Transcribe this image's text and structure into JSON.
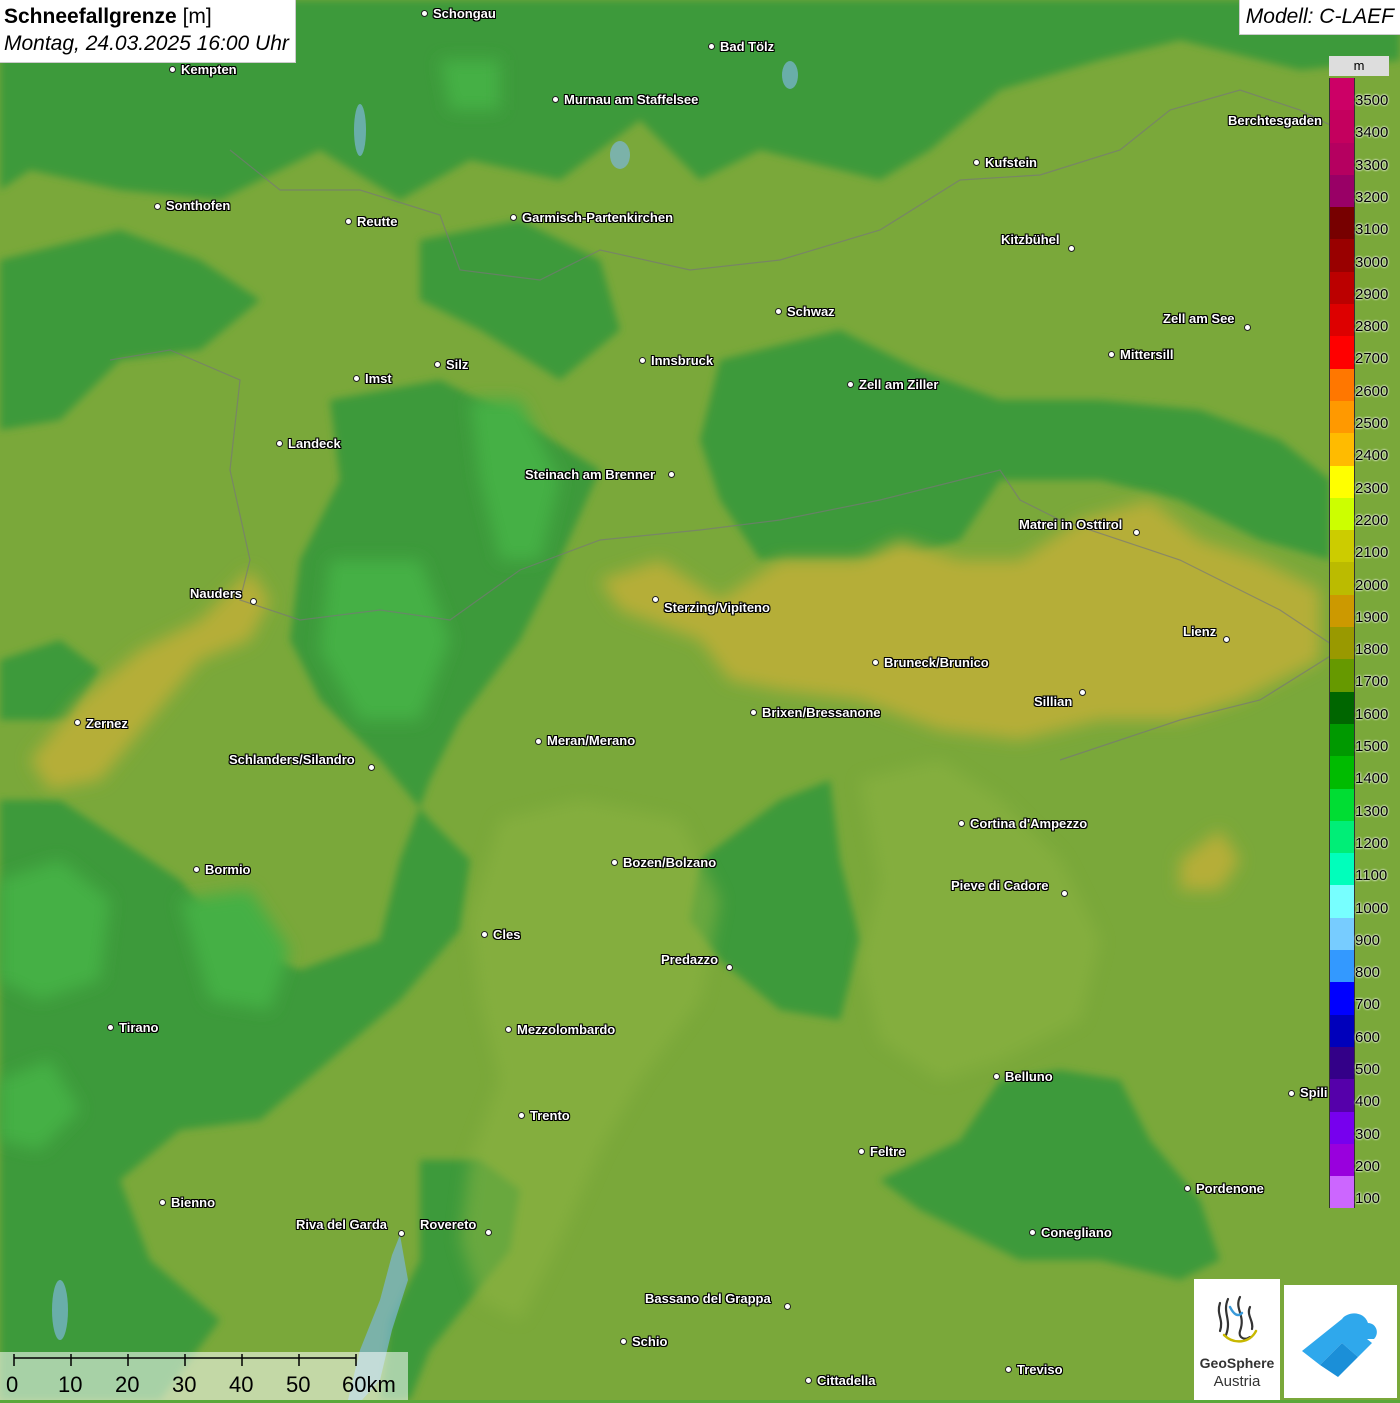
{
  "header": {
    "title_bold": "Schneefallgrenze",
    "title_unit": "[m]",
    "date": "Montag, 24.03.2025 16:00 Uhr",
    "model": "Modell: C-LAEF"
  },
  "legend": {
    "unit": "m",
    "items": [
      {
        "label": "3500",
        "color": "#cc0066"
      },
      {
        "label": "3400",
        "color": "#c4005e"
      },
      {
        "label": "3300",
        "color": "#b50060"
      },
      {
        "label": "3200",
        "color": "#990066"
      },
      {
        "label": "3100",
        "color": "#770000"
      },
      {
        "label": "3000",
        "color": "#990000"
      },
      {
        "label": "2900",
        "color": "#bb0000"
      },
      {
        "label": "2800",
        "color": "#dd0000"
      },
      {
        "label": "2700",
        "color": "#ff0000"
      },
      {
        "label": "2600",
        "color": "#ff7700"
      },
      {
        "label": "2500",
        "color": "#ff9900"
      },
      {
        "label": "2400",
        "color": "#ffbb00"
      },
      {
        "label": "2300",
        "color": "#ffff00"
      },
      {
        "label": "2200",
        "color": "#ccff00"
      },
      {
        "label": "2100",
        "color": "#cccc00"
      },
      {
        "label": "2000",
        "color": "#bbbb00"
      },
      {
        "label": "1900",
        "color": "#cc9900"
      },
      {
        "label": "1800",
        "color": "#999900"
      },
      {
        "label": "1700",
        "color": "#669900"
      },
      {
        "label": "1600",
        "color": "#006600"
      },
      {
        "label": "1500",
        "color": "#009900"
      },
      {
        "label": "1400",
        "color": "#00bb00"
      },
      {
        "label": "1300",
        "color": "#00dd33"
      },
      {
        "label": "1200",
        "color": "#00ee77"
      },
      {
        "label": "1100",
        "color": "#00ffbb"
      },
      {
        "label": "1000",
        "color": "#77ffff"
      },
      {
        "label": "900",
        "color": "#77ccff"
      },
      {
        "label": "800",
        "color": "#3399ff"
      },
      {
        "label": "700",
        "color": "#0000ff"
      },
      {
        "label": "600",
        "color": "#0000bb"
      },
      {
        "label": "500",
        "color": "#330088"
      },
      {
        "label": "400",
        "color": "#5500aa"
      },
      {
        "label": "300",
        "color": "#7700ee"
      },
      {
        "label": "200",
        "color": "#9900dd"
      },
      {
        "label": "100",
        "color": "#cc66ff"
      }
    ]
  },
  "cities": [
    {
      "name": "Schongau",
      "dot": [
        424,
        13
      ],
      "label": [
        433,
        14
      ],
      "align": "left"
    },
    {
      "name": "Kempten",
      "dot": [
        172,
        69
      ],
      "label": [
        181,
        70
      ],
      "align": "left"
    },
    {
      "name": "Bad Tölz",
      "dot": [
        711,
        46
      ],
      "label": [
        720,
        47
      ],
      "align": "left"
    },
    {
      "name": "Murnau am Staffelsee",
      "dot": [
        555,
        99
      ],
      "label": [
        564,
        100
      ],
      "align": "left"
    },
    {
      "name": "Berchtesgaden",
      "dot": null,
      "label": [
        1228,
        121
      ],
      "align": "left"
    },
    {
      "name": "Kufstein",
      "dot": [
        976,
        162
      ],
      "label": [
        985,
        163
      ],
      "align": "left"
    },
    {
      "name": "Sonthofen",
      "dot": [
        157,
        206
      ],
      "label": [
        166,
        206
      ],
      "align": "left"
    },
    {
      "name": "Reutte",
      "dot": [
        348,
        221
      ],
      "label": [
        357,
        222
      ],
      "align": "left"
    },
    {
      "name": "Garmisch-Partenkirchen",
      "dot": [
        513,
        217
      ],
      "label": [
        522,
        218
      ],
      "align": "left"
    },
    {
      "name": "Kitzbühel",
      "dot": [
        1071,
        248
      ],
      "label": [
        1001,
        240
      ],
      "align": "left"
    },
    {
      "name": "Schwaz",
      "dot": [
        778,
        311
      ],
      "label": [
        787,
        312
      ],
      "align": "left"
    },
    {
      "name": "Zell am See",
      "dot": [
        1247,
        327
      ],
      "label": [
        1163,
        319
      ],
      "align": "left"
    },
    {
      "name": "Mittersill",
      "dot": [
        1111,
        354
      ],
      "label": [
        1120,
        355
      ],
      "align": "left"
    },
    {
      "name": "Innsbruck",
      "dot": [
        642,
        360
      ],
      "label": [
        651,
        361
      ],
      "align": "left"
    },
    {
      "name": "Silz",
      "dot": [
        437,
        364
      ],
      "label": [
        446,
        365
      ],
      "align": "left"
    },
    {
      "name": "Imst",
      "dot": [
        356,
        378
      ],
      "label": [
        365,
        379
      ],
      "align": "left"
    },
    {
      "name": "Zell am Ziller",
      "dot": [
        850,
        384
      ],
      "label": [
        859,
        385
      ],
      "align": "left"
    },
    {
      "name": "Landeck",
      "dot": [
        279,
        443
      ],
      "label": [
        288,
        444
      ],
      "align": "left"
    },
    {
      "name": "Steinach am Brenner",
      "dot": [
        671,
        474
      ],
      "label": [
        525,
        475
      ],
      "align": "left"
    },
    {
      "name": "Matrei in Osttirol",
      "dot": [
        1136,
        532
      ],
      "label": [
        1019,
        525
      ],
      "align": "left"
    },
    {
      "name": "Nauders",
      "dot": [
        253,
        601
      ],
      "label": [
        190,
        594
      ],
      "align": "left"
    },
    {
      "name": "Sterzing/Vipiteno",
      "dot": [
        655,
        599
      ],
      "label": [
        664,
        608
      ],
      "align": "left"
    },
    {
      "name": "Lienz",
      "dot": [
        1226,
        639
      ],
      "label": [
        1183,
        632
      ],
      "align": "left"
    },
    {
      "name": "Bruneck/Brunico",
      "dot": [
        875,
        662
      ],
      "label": [
        884,
        663
      ],
      "align": "left"
    },
    {
      "name": "Sillian",
      "dot": [
        1082,
        692
      ],
      "label": [
        1034,
        702
      ],
      "align": "left"
    },
    {
      "name": "Brixen/Bressanone",
      "dot": [
        753,
        712
      ],
      "label": [
        762,
        713
      ],
      "align": "left"
    },
    {
      "name": "Zernez",
      "dot": [
        77,
        722
      ],
      "label": [
        86,
        724
      ],
      "align": "left"
    },
    {
      "name": "Meran/Merano",
      "dot": [
        538,
        741
      ],
      "label": [
        547,
        741
      ],
      "align": "left"
    },
    {
      "name": "Schlanders/Silandro",
      "dot": [
        371,
        767
      ],
      "label": [
        229,
        760
      ],
      "align": "left"
    },
    {
      "name": "Cortina d'Ampezzo",
      "dot": [
        961,
        823
      ],
      "label": [
        970,
        824
      ],
      "align": "left"
    },
    {
      "name": "Bozen/Bolzano",
      "dot": [
        614,
        862
      ],
      "label": [
        623,
        863
      ],
      "align": "left"
    },
    {
      "name": "Bormio",
      "dot": [
        196,
        869
      ],
      "label": [
        205,
        870
      ],
      "align": "left"
    },
    {
      "name": "Pieve di Cadore",
      "dot": [
        1064,
        893
      ],
      "label": [
        951,
        886
      ],
      "align": "left"
    },
    {
      "name": "Cles",
      "dot": [
        484,
        934
      ],
      "label": [
        493,
        935
      ],
      "align": "left"
    },
    {
      "name": "Predazzo",
      "dot": [
        729,
        967
      ],
      "label": [
        661,
        960
      ],
      "align": "left"
    },
    {
      "name": "Tirano",
      "dot": [
        110,
        1027
      ],
      "label": [
        119,
        1028
      ],
      "align": "left"
    },
    {
      "name": "Mezzolombardo",
      "dot": [
        508,
        1029
      ],
      "label": [
        517,
        1030
      ],
      "align": "left"
    },
    {
      "name": "Belluno",
      "dot": [
        996,
        1076
      ],
      "label": [
        1005,
        1077
      ],
      "align": "left"
    },
    {
      "name": "Spili",
      "dot": [
        1291,
        1093
      ],
      "label": [
        1300,
        1093
      ],
      "align": "left"
    },
    {
      "name": "Trento",
      "dot": [
        521,
        1115
      ],
      "label": [
        530,
        1116
      ],
      "align": "left"
    },
    {
      "name": "Feltre",
      "dot": [
        861,
        1151
      ],
      "label": [
        870,
        1152
      ],
      "align": "left"
    },
    {
      "name": "Pordenone",
      "dot": [
        1187,
        1188
      ],
      "label": [
        1196,
        1189
      ],
      "align": "left"
    },
    {
      "name": "Bienno",
      "dot": [
        162,
        1202
      ],
      "label": [
        171,
        1203
      ],
      "align": "left"
    },
    {
      "name": "Riva del Garda",
      "dot": [
        401,
        1233
      ],
      "label": [
        296,
        1225
      ],
      "align": "left"
    },
    {
      "name": "Rovereto",
      "dot": [
        488,
        1232
      ],
      "label": [
        420,
        1225
      ],
      "align": "left"
    },
    {
      "name": "Conegliano",
      "dot": [
        1032,
        1232
      ],
      "label": [
        1041,
        1233
      ],
      "align": "left"
    },
    {
      "name": "Bassano del Grappa",
      "dot": [
        787,
        1306
      ],
      "label": [
        645,
        1299
      ],
      "align": "left"
    },
    {
      "name": "Schio",
      "dot": [
        623,
        1341
      ],
      "label": [
        632,
        1342
      ],
      "align": "left"
    },
    {
      "name": "Treviso",
      "dot": [
        1008,
        1369
      ],
      "label": [
        1017,
        1370
      ],
      "align": "left"
    },
    {
      "name": "Cittadella",
      "dot": [
        808,
        1380
      ],
      "label": [
        817,
        1381
      ],
      "align": "left"
    }
  ],
  "scale_bar": {
    "labels": [
      "0",
      "10",
      "20",
      "30",
      "40",
      "50",
      "60km"
    ]
  },
  "logos": {
    "geosphere_line1": "GeoSphere",
    "geosphere_line2": "Austria"
  }
}
